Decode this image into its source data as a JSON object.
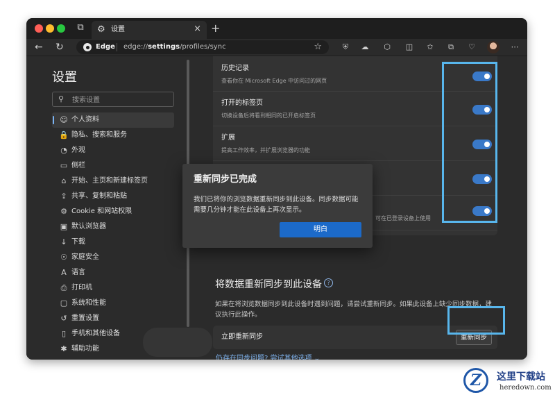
{
  "window": {
    "tab_title": "设置",
    "address": {
      "brand": "Edge",
      "url_prefix": "edge://",
      "url_bold": "settings",
      "url_suffix": "/profiles/sync"
    }
  },
  "sidebar": {
    "title": "设置",
    "search_placeholder": "搜索设置",
    "items": [
      {
        "label": "个人资料",
        "icon": "profile-icon",
        "glyph": "☺",
        "active": true
      },
      {
        "label": "隐私、搜索和服务",
        "icon": "lock-icon",
        "glyph": "🔒"
      },
      {
        "label": "外观",
        "icon": "palette-icon",
        "glyph": "◔"
      },
      {
        "label": "侧栏",
        "icon": "sidebar-icon",
        "glyph": "▭"
      },
      {
        "label": "开始、主页和新建标签页",
        "icon": "home-icon",
        "glyph": "⌂"
      },
      {
        "label": "共享、复制和粘贴",
        "icon": "share-icon",
        "glyph": "⇪"
      },
      {
        "label": "Cookie 和网站权限",
        "icon": "cookie-icon",
        "glyph": "⚙"
      },
      {
        "label": "默认浏览器",
        "icon": "browser-icon",
        "glyph": "▣"
      },
      {
        "label": "下载",
        "icon": "download-icon",
        "glyph": "↓"
      },
      {
        "label": "家庭安全",
        "icon": "family-icon",
        "glyph": "☉"
      },
      {
        "label": "语言",
        "icon": "language-icon",
        "glyph": "A"
      },
      {
        "label": "打印机",
        "icon": "printer-icon",
        "glyph": "⎙"
      },
      {
        "label": "系统和性能",
        "icon": "system-icon",
        "glyph": "▢"
      },
      {
        "label": "重置设置",
        "icon": "reset-icon",
        "glyph": "↺"
      },
      {
        "label": "手机和其他设备",
        "icon": "phone-icon",
        "glyph": "▯"
      },
      {
        "label": "辅助功能",
        "icon": "accessibility-icon",
        "glyph": "✱"
      }
    ]
  },
  "sync_items": [
    {
      "title": "历史记录",
      "desc": "查看你在 Microsoft Edge 中访问过的网页",
      "on": true
    },
    {
      "title": "打开的标签页",
      "desc": "切换设备后将看到相同的已开启标签页",
      "on": true
    },
    {
      "title": "扩展",
      "desc": "提高工作效率，并扩展浏览器的功能",
      "on": true
    },
    {
      "title": "",
      "desc": "",
      "on": true
    },
    {
      "title": "",
      "desc": "可在已登录设备上使用",
      "on": true
    }
  ],
  "resync_section": {
    "heading": "将数据重新同步到此设备",
    "help_glyph": "?",
    "description": "如果在将浏览数据同步到此设备时遇到问题，请尝试重新同步。如果此设备上缺少同步数据，建议执行此操作。",
    "row_label": "立即重新同步",
    "button_label": "重新同步",
    "link": "仍存在同步问题? 尝试其他选项 ⌄"
  },
  "dialog": {
    "title": "重新同步已完成",
    "body": "我们已将你的浏览数据重新同步到此设备。同步数据可能需要几分钟才能在此设备上再次显示。",
    "ok_label": "明白"
  },
  "watermark": {
    "cn": "这里下载站",
    "en": "heredown.com"
  },
  "colors": {
    "accent": "#3a79c8",
    "highlight": "#58b6ec",
    "primary_button": "#1c6ac9",
    "background": "#2b2b2b"
  }
}
